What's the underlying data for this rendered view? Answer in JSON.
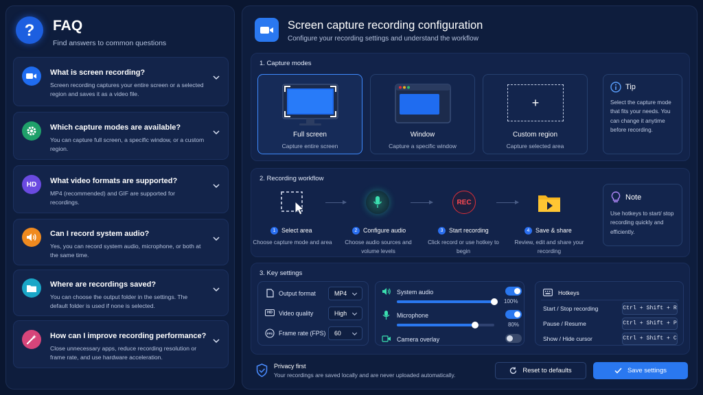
{
  "faq": {
    "icon": "question-mark-icon",
    "title": "FAQ",
    "subtitle": "Find answers to common questions",
    "items": [
      {
        "icon": "video-camera-icon",
        "question": "What is screen recording?",
        "answer": "Screen recording captures your entire screen or a selected region and saves it as a video file.",
        "icon_color": "#1f6cf0"
      },
      {
        "icon": "gear-icon",
        "question": "Which capture modes are available?",
        "answer": "You can capture full screen, a specific window, or a custom region.",
        "icon_color": "#1fa06a"
      },
      {
        "icon_text": "HD",
        "icon": "hd-icon",
        "question": "What video formats are supported?",
        "answer": "MP4 (recommended) and GIF are supported for recordings.",
        "icon_color": "#6a4ae0"
      },
      {
        "icon": "speaker-icon",
        "question": "Can I record system audio?",
        "answer": "Yes, you can record system audio, microphone, or both at the same time.",
        "icon_color": "#f08a1f"
      },
      {
        "icon": "folder-icon",
        "question": "Where are recordings saved?",
        "answer": "You can choose the output folder in the settings. The default folder is used if none is selected.",
        "icon_color": "#1aa6c7"
      },
      {
        "icon": "magic-wand-icon",
        "question": "How can I improve recording performance?",
        "answer": "Close unnecessary apps, reduce recording resolution or frame rate, and use hardware acceleration.",
        "icon_color": "#d6457a"
      }
    ]
  },
  "header": {
    "icon": "video-camera-icon",
    "title": "Screen capture recording configuration",
    "subtitle": "Configure your recording settings and understand the workflow"
  },
  "capture_modes": {
    "title": "1. Capture modes",
    "modes": [
      {
        "name": "Full screen",
        "desc": "Capture entire screen",
        "selected": true,
        "icon": "monitor-icon"
      },
      {
        "name": "Window",
        "desc": "Capture a specific window",
        "selected": false,
        "icon": "window-icon"
      },
      {
        "name": "Custom region",
        "desc": "Capture selected area",
        "selected": false,
        "icon": "region-select-icon",
        "glyph": "+"
      }
    ],
    "tip": {
      "icon": "info-icon",
      "title": "Tip",
      "text": "Select the capture mode that fits your needs. You can change it anytime before recording."
    }
  },
  "workflow": {
    "title": "2. Recording workflow",
    "steps": [
      {
        "num": "1",
        "label": "Select area",
        "desc": "Choose capture mode and area",
        "icon": "select-area-icon"
      },
      {
        "num": "2",
        "label": "Configure audio",
        "desc": "Choose audio sources and volume levels",
        "icon": "microphone-icon"
      },
      {
        "num": "3",
        "label": "Start recording",
        "desc": "Click record or use hotkey to begin",
        "icon": "record-icon",
        "icon_text": "REC"
      },
      {
        "num": "4",
        "label": "Save & share",
        "desc": "Review, edit and share your recording",
        "icon": "folder-play-icon"
      }
    ],
    "note": {
      "icon": "lightbulb-icon",
      "title": "Note",
      "text": "Use hotkeys to start/ stop recording quickly and efficiently."
    }
  },
  "settings": {
    "title": "3. Key settings",
    "output_format": {
      "label": "Output format",
      "value": "MP4",
      "icon": "file-icon"
    },
    "video_quality": {
      "label": "Video quality",
      "value": "High",
      "icon": "hd-icon"
    },
    "frame_rate": {
      "label": "Frame rate (FPS)",
      "value": "60",
      "icon": "fps-icon"
    },
    "system_audio": {
      "label": "System audio",
      "enabled": true,
      "level": 100,
      "level_text": "100%",
      "icon": "speaker-icon"
    },
    "microphone": {
      "label": "Microphone",
      "enabled": true,
      "level": 80,
      "level_text": "80%",
      "icon": "microphone-icon"
    },
    "camera_overlay": {
      "label": "Camera overlay",
      "enabled": false,
      "icon": "camera-icon"
    },
    "hotkeys": {
      "icon": "keyboard-icon",
      "title": "Hotkeys",
      "items": [
        {
          "label": "Start / Stop recording",
          "keys": "Ctrl + Shift + R"
        },
        {
          "label": "Pause / Resume",
          "keys": "Ctrl + Shift + P"
        },
        {
          "label": "Show / Hide cursor",
          "keys": "Ctrl + Shift + C"
        }
      ]
    }
  },
  "footer": {
    "privacy_title": "Privacy first",
    "privacy_text": "Your recordings are saved locally and are never uploaded automatically.",
    "reset_label": "Reset to defaults",
    "save_label": "Save settings"
  },
  "colors": {
    "accent": "#2a78f0",
    "background": "#0a1630",
    "panel": "#0e1d3d",
    "record_red": "#e0303a"
  }
}
